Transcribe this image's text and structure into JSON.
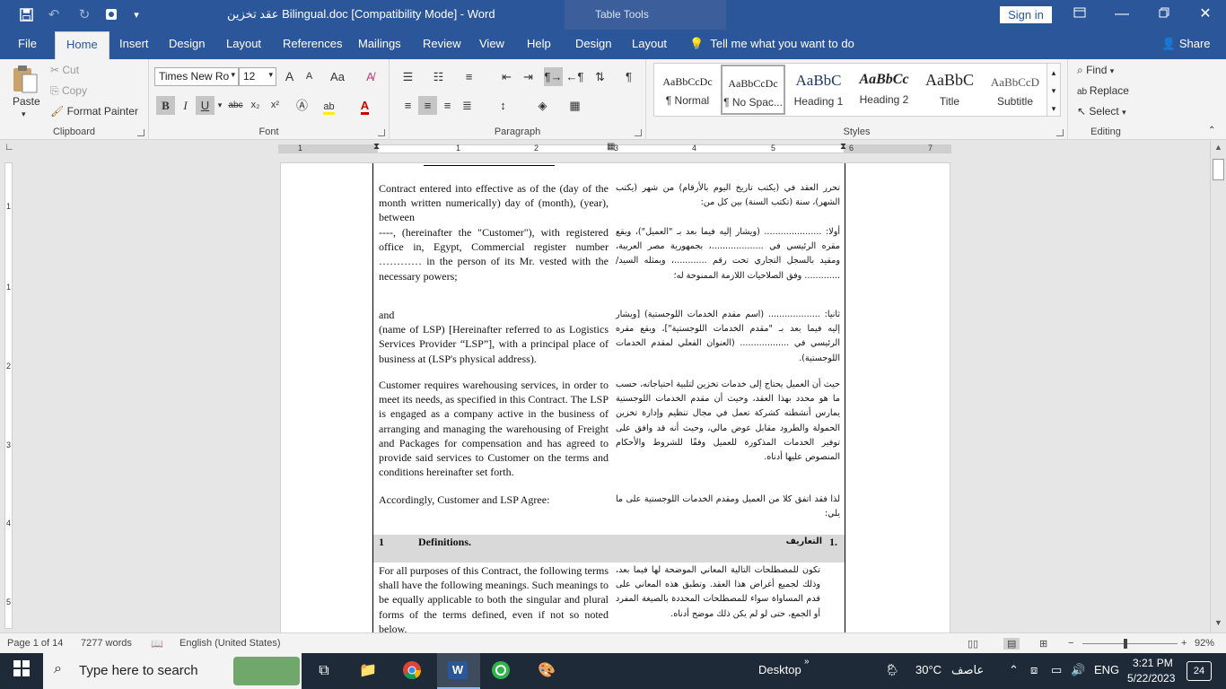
{
  "title_bar": {
    "doc_title": "عقد تخزين Bilingual.doc [Compatibility Mode]  -  Word",
    "context_tab": "Table Tools",
    "sign_in": "Sign in",
    "quick_access": [
      "save-icon",
      "undo-icon",
      "redo-icon",
      "touch-mode-icon",
      "customize-icon"
    ]
  },
  "tabs": {
    "items": [
      "File",
      "Home",
      "Insert",
      "Design",
      "Layout",
      "References",
      "Mailings",
      "Review",
      "View",
      "Help",
      "Design",
      "Layout"
    ],
    "tell_me": "Tell me what you want to do",
    "share": "Share"
  },
  "ribbon": {
    "clipboard": {
      "paste": "Paste",
      "cut": "Cut",
      "copy": "Copy",
      "format_painter": "Format Painter",
      "label": "Clipboard"
    },
    "font": {
      "name": "Times New Ro",
      "size": "12",
      "label": "Font",
      "bold": "B",
      "italic": "I",
      "underline": "U",
      "strike": "abc",
      "sub": "x₂",
      "sup": "x²",
      "grow": "A",
      "shrink": "A",
      "case": "Aa"
    },
    "paragraph": {
      "label": "Paragraph"
    },
    "styles": {
      "label": "Styles",
      "items": [
        {
          "sample": "AaBbCcDc",
          "name": "¶ Normal"
        },
        {
          "sample": "AaBbCcDc",
          "name": "¶ No Spac..."
        },
        {
          "sample": "AaBbC",
          "name": "Heading 1"
        },
        {
          "sample": "AaBbCc",
          "name": "Heading 2"
        },
        {
          "sample": "AaBbC",
          "name": "Title"
        },
        {
          "sample": "AaBbCcD",
          "name": "Subtitle"
        }
      ]
    },
    "editing": {
      "find": "Find",
      "replace": "Replace",
      "select": "Select",
      "label": "Editing"
    }
  },
  "ruler": {
    "h_numbers": [
      "1",
      "1",
      "2",
      "3",
      "4",
      "5",
      "6",
      "7"
    ],
    "v_numbers": [
      "1",
      "1",
      "2",
      "3",
      "4",
      "5",
      "6"
    ]
  },
  "document": {
    "rows": [
      {
        "en": "Contract entered into effective as of the (day of the month written numerically) day of (month), (year), between",
        "ar": "تحرر العقد في (يكتب تاريخ اليوم بالأرقام) من شهر (يكتب الشهر)، سنة (تكتب السنة) بين كل من:"
      },
      {
        "en": "----, (hereinafter the \"Customer\"), with registered office in, Egypt, Commercial register number ………… in the person of its Mr. vested with the necessary powers;",
        "ar": "أولا: ..................... (ويشار إليه فيما بعد بـ \"العميل\")، ويقع مقره الرئيسي في ...................، بجمهورية مصر العربية، ومقيد بالسجل التجاري تحت رقم ............، ويمثله السيد/ ............. وفق الصلاحيات اللازمة الممنوحة له؛"
      },
      {
        "en": "and\n(name of LSP) [Hereinafter referred to as Logistics Services Provider “LSP”], with a principal place of business at (LSP's physical address).",
        "ar": "ثانيا: ................... (اسم مقدم الخدمات اللوجستية) [ويشار إليه فيما بعد بـ \"مقدم الخدمات اللوجستية\"]، ويقع مقره الرئيسي في .................. (العنوان الفعلي لمقدم الخدمات اللوجستية)."
      },
      {
        "en": "Customer requires warehousing services, in order to meet its needs, as specified in this Contract. The LSP is engaged as a company active in the business of arranging and managing the warehousing of Freight and Packages for compensation and has agreed to provide said services to Customer on the terms and conditions hereinafter set forth.",
        "ar": "حيث أن العميل يحتاج إلى خدمات تخزين لتلبية احتياجاته، حسب ما هو محدد بهذا العقد، وحيث أن مقدم الخدمات اللوجستية يمارس أنشطته كشركة تعمل في مجال تنظيم وإدارة تخزين الحمولة والطرود مقابل عوض مالي، وحيث أنه قد وافق على توفير الخدمات المذكورة للعميل وفقًا للشروط والأحكام المنصوص عليها أدناه."
      },
      {
        "en": "Accordingly, Customer and LSP Agree:",
        "ar": "لذا فقد اتفق كلا من العميل ومقدم الخدمات اللوجستية على ما يلي:"
      },
      {
        "en": "For all purposes of this Contract, the following terms shall have the following meanings. Such meanings to be equally applicable to both the singular and plural forms of the terms defined, even if not so noted below.",
        "ar": "تكون للمصطلحات التالية المعاني الموضحة لها فيما بعد، وذلك لجميع أغراض هذا العقد. وتطبق هذه المعاني على قدم المساواة سواء للمصطلحات المحددة بالصيغة المفرد أو الجمع، حتى لو لم يكن ذلك موضح أدناه."
      }
    ],
    "definitions": {
      "num": "1",
      "en": "Definitions.",
      "ar_num": "1.",
      "ar": "التعاريف"
    }
  },
  "status_bar": {
    "page": "Page 1 of 14",
    "words": "7277 words",
    "language": "English (United States)",
    "zoom": "92%",
    "zoom_level": 0.92
  },
  "taskbar": {
    "search": "Type here to search",
    "desktop": "Desktop",
    "temp": "30°C",
    "weather": "عاصف",
    "lang": "ENG",
    "time": "3:21 PM",
    "date": "5/22/2023",
    "badge": "24"
  }
}
